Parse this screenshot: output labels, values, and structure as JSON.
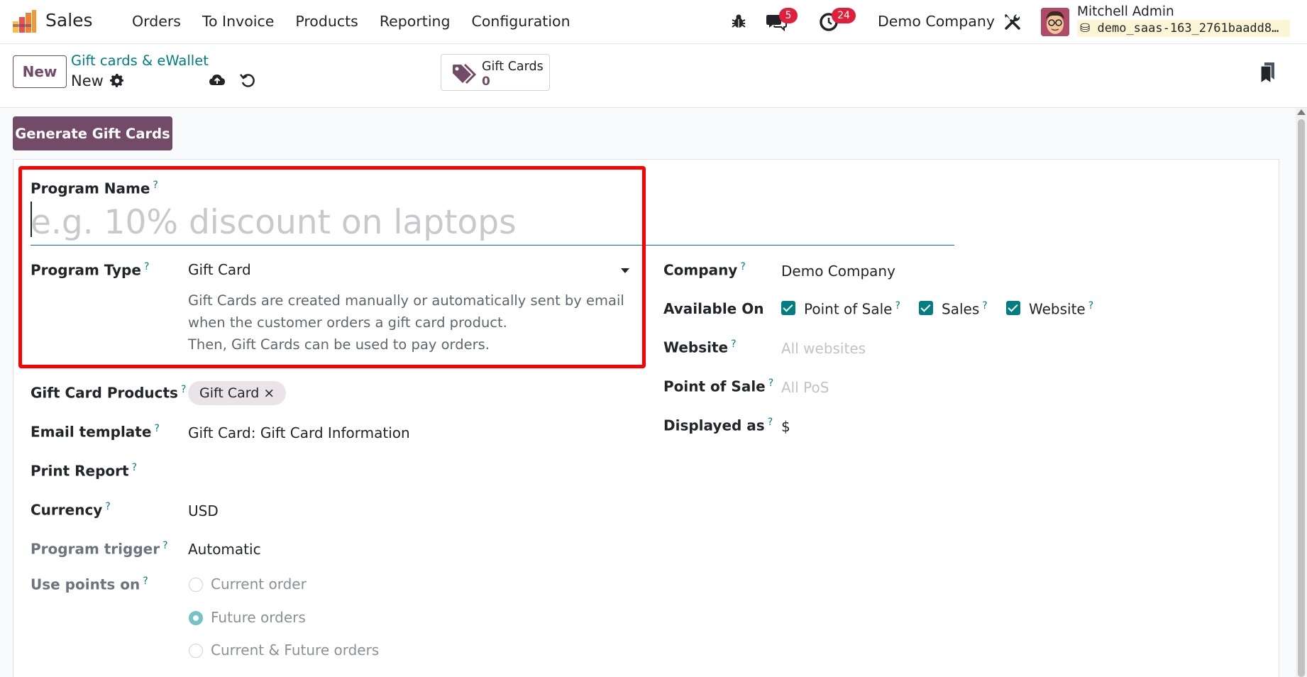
{
  "navbar": {
    "app_name": "Sales",
    "menu": [
      "Orders",
      "To Invoice",
      "Products",
      "Reporting",
      "Configuration"
    ],
    "chat_count": "5",
    "activity_count": "24",
    "company": "Demo Company",
    "user_name": "Mitchell Admin",
    "database": "demo_saas-163_2761baadd8…"
  },
  "control_panel": {
    "new_label": "New",
    "breadcrumb_parent": "Gift cards & eWallet",
    "breadcrumb_current": "New",
    "smart_button": {
      "label": "Gift Cards",
      "value": "0"
    }
  },
  "actions": {
    "generate_label": "Generate Gift Cards"
  },
  "form": {
    "program_name": {
      "label": "Program Name",
      "help": "?",
      "placeholder": "e.g. 10% discount on laptops",
      "value": ""
    },
    "program_type": {
      "label": "Program Type",
      "help": "?",
      "value": "Gift Card",
      "description": [
        "Gift Cards are created manually or automatically sent by email",
        "when the customer orders a gift card product.",
        "Then, Gift Cards can be used to pay orders."
      ]
    },
    "gift_card_products": {
      "label": "Gift Card Products",
      "help": "?",
      "tag": "Gift Card",
      "remove": "×"
    },
    "email_template": {
      "label": "Email template",
      "help": "?",
      "value": "Gift Card: Gift Card Information"
    },
    "print_report": {
      "label": "Print Report",
      "help": "?"
    },
    "currency": {
      "label": "Currency",
      "help": "?",
      "value": "USD"
    },
    "program_trigger": {
      "label": "Program trigger",
      "help": "?",
      "value": "Automatic"
    },
    "use_points_on": {
      "label": "Use points on",
      "help": "?",
      "options": [
        "Current order",
        "Future orders",
        "Current & Future orders"
      ],
      "selected": "Future orders"
    },
    "company": {
      "label": "Company",
      "help": "?",
      "value": "Demo Company"
    },
    "available_on": {
      "label": "Available On",
      "options": [
        {
          "label": "Point of Sale",
          "help": "?",
          "checked": true
        },
        {
          "label": "Sales",
          "help": "?",
          "checked": true
        },
        {
          "label": "Website",
          "help": "?",
          "checked": true
        }
      ]
    },
    "website": {
      "label": "Website",
      "help": "?",
      "placeholder": "All websites"
    },
    "point_of_sale": {
      "label": "Point of Sale",
      "help": "?",
      "placeholder": "All PoS"
    },
    "displayed_as": {
      "label": "Displayed as",
      "help": "?",
      "value": "$"
    }
  },
  "colors": {
    "brand": "#714B67",
    "accent": "#017e84",
    "highlight": "#ff0000",
    "badge": "#e0203a"
  }
}
